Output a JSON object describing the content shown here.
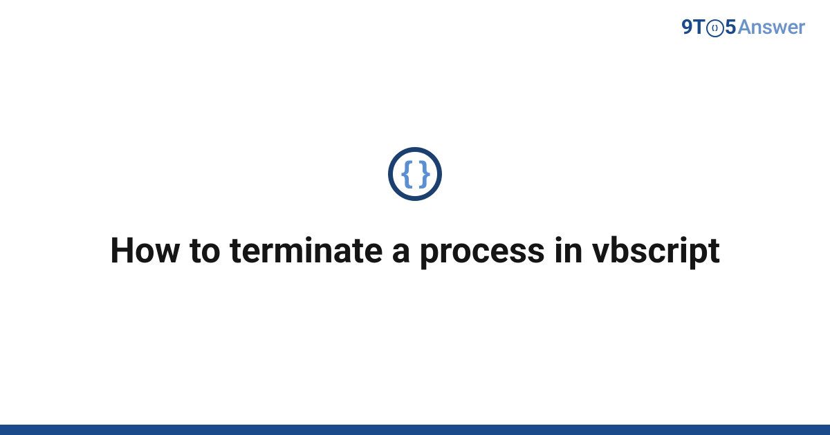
{
  "brand": {
    "prefix": "9T",
    "middle_icon": "braces-icon",
    "suffix_digit": "5",
    "suffix_word": "Answer"
  },
  "category": {
    "icon": "code-braces-icon",
    "glyph": "{ }"
  },
  "title": "How to terminate a process in vbscript",
  "colors": {
    "brand_dark": "#1b4a8a",
    "brand_light": "#6b93c8",
    "icon_ring": "#1b3f6e",
    "icon_glyph": "#5a8fd4",
    "text": "#151515"
  }
}
